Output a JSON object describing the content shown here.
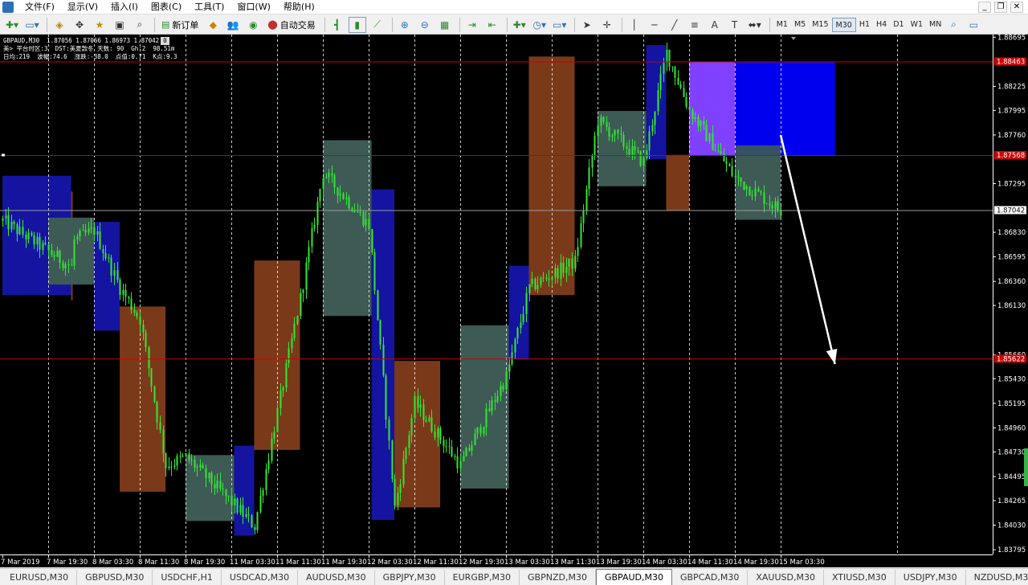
{
  "menubar": {
    "items": [
      "文件(F)",
      "显示(V)",
      "插入(I)",
      "图表(C)",
      "工具(T)",
      "窗口(W)",
      "帮助(H)"
    ]
  },
  "toolbar": {
    "new_order_label": "新订单",
    "auto_trade_label": "自动交易",
    "timeframes": [
      "M1",
      "M5",
      "M15",
      "M30",
      "H1",
      "H4",
      "D1",
      "W1",
      "MN"
    ],
    "active_timeframe": "M30"
  },
  "chart_info": {
    "line1": "GBPAUD,M30  1.87056 1.87066 1.86973 1.87042",
    "line2": "美> 平台时区:3  DST:美夏款冬 天数: 90  Gh:2  98.51m",
    "line3": "日均:219  波幅:74.6  涨跌:-38.0  点值:0.71  K点:9.3",
    "badge": "0"
  },
  "price_axis": {
    "ticks": [
      "1.88695",
      "1.88225",
      "1.87995",
      "1.87760",
      "1.87295",
      "1.86830",
      "1.86595",
      "1.86360",
      "1.86130",
      "1.85660",
      "1.85430",
      "1.85195",
      "1.84960",
      "1.84730",
      "1.84495",
      "1.84265",
      "1.84030",
      "1.83795"
    ],
    "red_labels": [
      {
        "text": "1.88463",
        "price": 1.88463
      },
      {
        "text": "1.87568",
        "price": 1.87568
      },
      {
        "text": "1.85622",
        "price": 1.85622
      }
    ],
    "current_price": "1.87042",
    "current_price_value": 1.87042
  },
  "time_axis": {
    "ticks": [
      "7 Mar 2019",
      "7 Mar 19:30",
      "8 Mar 03:30",
      "8 Mar 11:30",
      "8 Mar 19:30",
      "11 Mar 03:30",
      "11 Mar 11:30",
      "11 Mar 19:30",
      "12 Mar 03:30",
      "12 Mar 11:30",
      "12 Mar 19:30",
      "13 Mar 03:30",
      "13 Mar 11:30",
      "13 Mar 19:30",
      "14 Mar 03:30",
      "14 Mar 11:30",
      "14 Mar 19:30",
      "15 Mar 03:30"
    ]
  },
  "colors": {
    "background": "#000000",
    "candle": "#33e833",
    "grid": "#ffffff",
    "level_line": "#cc0000",
    "box_blue": "#1414a0",
    "box_brown": "#7a3a1a",
    "box_gray": "#3d5a55",
    "target_box": "#0000ee",
    "target_box_purple": "#8040ff",
    "arrow": "#ffffff",
    "axis_text": "#ffffff"
  },
  "chart_data": {
    "type": "candlestick",
    "symbol": "GBPAUD",
    "timeframe": "M30",
    "ylim": [
      1.8375,
      1.8872
    ],
    "horizontal_levels": [
      1.88463,
      1.87568,
      1.85622
    ],
    "current_price": 1.87042,
    "session_boxes": [
      {
        "color": "blue",
        "from": "7 Mar 2019",
        "to": "7 Mar 12:00",
        "high": 1.8737,
        "low": 1.8623
      },
      {
        "color": "brown",
        "from": "7 Mar 12:00",
        "to": "7 Mar 19:30",
        "high": 1.8722,
        "low": 1.8618
      },
      {
        "color": "gray",
        "from": "7 Mar 19:30",
        "to": "8 Mar 03:30",
        "high": 1.8697,
        "low": 1.8633
      },
      {
        "color": "blue",
        "from": "8 Mar 03:30",
        "to": "8 Mar 08:00",
        "high": 1.8693,
        "low": 1.8589
      },
      {
        "color": "brown",
        "from": "8 Mar 08:00",
        "to": "8 Mar 16:00",
        "high": 1.8612,
        "low": 1.8435
      },
      {
        "color": "gray",
        "from": "8 Mar 19:30",
        "to": "11 Mar 04:00",
        "high": 1.847,
        "low": 1.8407
      },
      {
        "color": "blue",
        "from": "11 Mar 04:00",
        "to": "11 Mar 07:30",
        "high": 1.8479,
        "low": 1.8393
      },
      {
        "color": "brown",
        "from": "11 Mar 07:30",
        "to": "11 Mar 15:30",
        "high": 1.8656,
        "low": 1.8475
      },
      {
        "color": "gray",
        "from": "11 Mar 19:30",
        "to": "12 Mar 04:00",
        "high": 1.8771,
        "low": 1.8603
      },
      {
        "color": "blue",
        "from": "12 Mar 04:00",
        "to": "12 Mar 08:00",
        "high": 1.8724,
        "low": 1.8408
      },
      {
        "color": "brown",
        "from": "12 Mar 08:00",
        "to": "12 Mar 16:00",
        "high": 1.856,
        "low": 1.842
      },
      {
        "color": "gray",
        "from": "12 Mar 19:30",
        "to": "13 Mar 04:00",
        "high": 1.8594,
        "low": 1.8438
      },
      {
        "color": "blue",
        "from": "13 Mar 04:00",
        "to": "13 Mar 07:30",
        "high": 1.8651,
        "low": 1.8562
      },
      {
        "color": "brown",
        "from": "13 Mar 07:30",
        "to": "13 Mar 15:30",
        "high": 1.8851,
        "low": 1.8623
      },
      {
        "color": "gray",
        "from": "13 Mar 19:30",
        "to": "14 Mar 04:00",
        "high": 1.8799,
        "low": 1.8727
      },
      {
        "color": "blue",
        "from": "14 Mar 04:00",
        "to": "14 Mar 07:30",
        "high": 1.8862,
        "low": 1.8753
      },
      {
        "color": "brown",
        "from": "14 Mar 07:30",
        "to": "14 Mar 11:30",
        "high": 1.8757,
        "low": 1.8704
      },
      {
        "color": "gray",
        "from": "14 Mar 19:30",
        "to": "15 Mar 03:30",
        "high": 1.8766,
        "low": 1.8695
      }
    ],
    "target_zone": {
      "from": "14 Mar 11:30",
      "to": "15 Mar 13:00",
      "high": 1.88463,
      "low": 1.87568
    },
    "arrow": {
      "from_time": "15 Mar 03:30",
      "from_price": 1.8776,
      "to_time": "15 Mar 13:00",
      "to_price": 1.8557
    },
    "close_path": [
      [
        "7 Mar 2019",
        1.8694
      ],
      [
        "7 Mar 12:00",
        1.865
      ],
      [
        "7 Mar 19:30",
        1.8663
      ],
      [
        "8 Mar 03:30",
        1.8685
      ],
      [
        "8 Mar 08:00",
        1.863
      ],
      [
        "8 Mar 11:30",
        1.86
      ],
      [
        "8 Mar 16:00",
        1.846
      ],
      [
        "8 Mar 19:30",
        1.8468
      ],
      [
        "11 Mar 03:30",
        1.8425
      ],
      [
        "11 Mar 07:30",
        1.8402
      ],
      [
        "11 Mar 15:30",
        1.862
      ],
      [
        "11 Mar 19:30",
        1.874
      ],
      [
        "12 Mar 03:30",
        1.869
      ],
      [
        "12 Mar 08:00",
        1.842
      ],
      [
        "12 Mar 11:30",
        1.852
      ],
      [
        "12 Mar 19:30",
        1.846
      ],
      [
        "13 Mar 03:30",
        1.8545
      ],
      [
        "13 Mar 07:30",
        1.863
      ],
      [
        "13 Mar 15:30",
        1.8655
      ],
      [
        "13 Mar 19:30",
        1.879
      ],
      [
        "14 Mar 03:30",
        1.875
      ],
      [
        "14 Mar 07:30",
        1.8855
      ],
      [
        "14 Mar 11:30",
        1.88
      ],
      [
        "14 Mar 19:30",
        1.8735
      ],
      [
        "15 Mar 03:30",
        1.8704
      ]
    ]
  },
  "symbol_tabs": [
    "EURUSD,M30",
    "GBPUSD,M30",
    "USDCHF,H1",
    "USDCAD,M30",
    "AUDUSD,M30",
    "GBPJPY,M30",
    "EURGBP,M30",
    "GBPNZD,M30",
    "GBPAUD,M30",
    "GBPCAD,M30",
    "XAUUSD,M30",
    "XTIUSD,M30",
    "USDJPY,M30",
    "NZDUSD,M30"
  ],
  "active_tab": "GBPAUD,M30"
}
